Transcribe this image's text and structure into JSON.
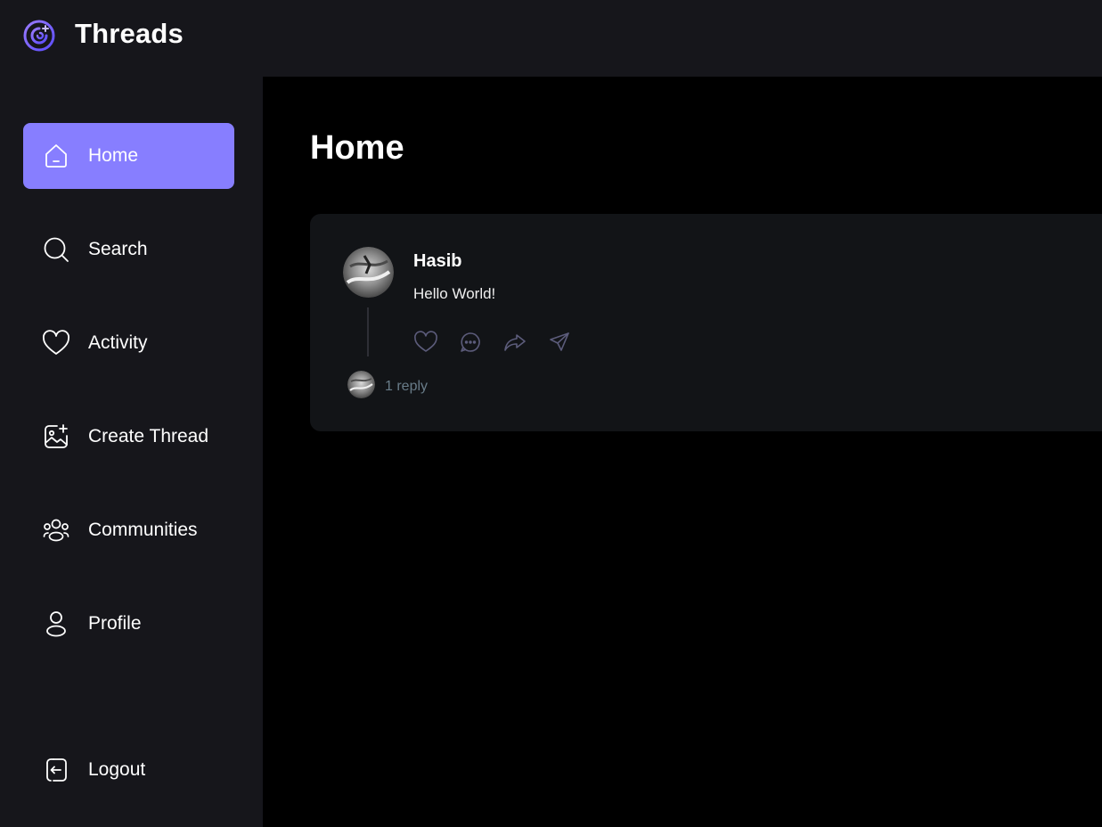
{
  "app": {
    "title": "Threads",
    "logo_icon": "threads-logo-icon",
    "accent_color": "#877eff"
  },
  "sidebar": {
    "items": [
      {
        "label": "Home",
        "icon": "home-icon",
        "active": true
      },
      {
        "label": "Search",
        "icon": "search-icon",
        "active": false
      },
      {
        "label": "Activity",
        "icon": "heart-icon",
        "active": false
      },
      {
        "label": "Create Thread",
        "icon": "create-image-icon",
        "active": false
      },
      {
        "label": "Communities",
        "icon": "communities-icon",
        "active": false
      },
      {
        "label": "Profile",
        "icon": "user-icon",
        "active": false
      }
    ],
    "logout": {
      "label": "Logout",
      "icon": "logout-icon"
    }
  },
  "main": {
    "title": "Home",
    "threads": [
      {
        "author": "Hasib",
        "content": "Hello World!",
        "actions": [
          "heart-icon",
          "reply-icon",
          "repost-icon",
          "share-icon"
        ],
        "reply_count_label": "1 reply"
      }
    ]
  }
}
